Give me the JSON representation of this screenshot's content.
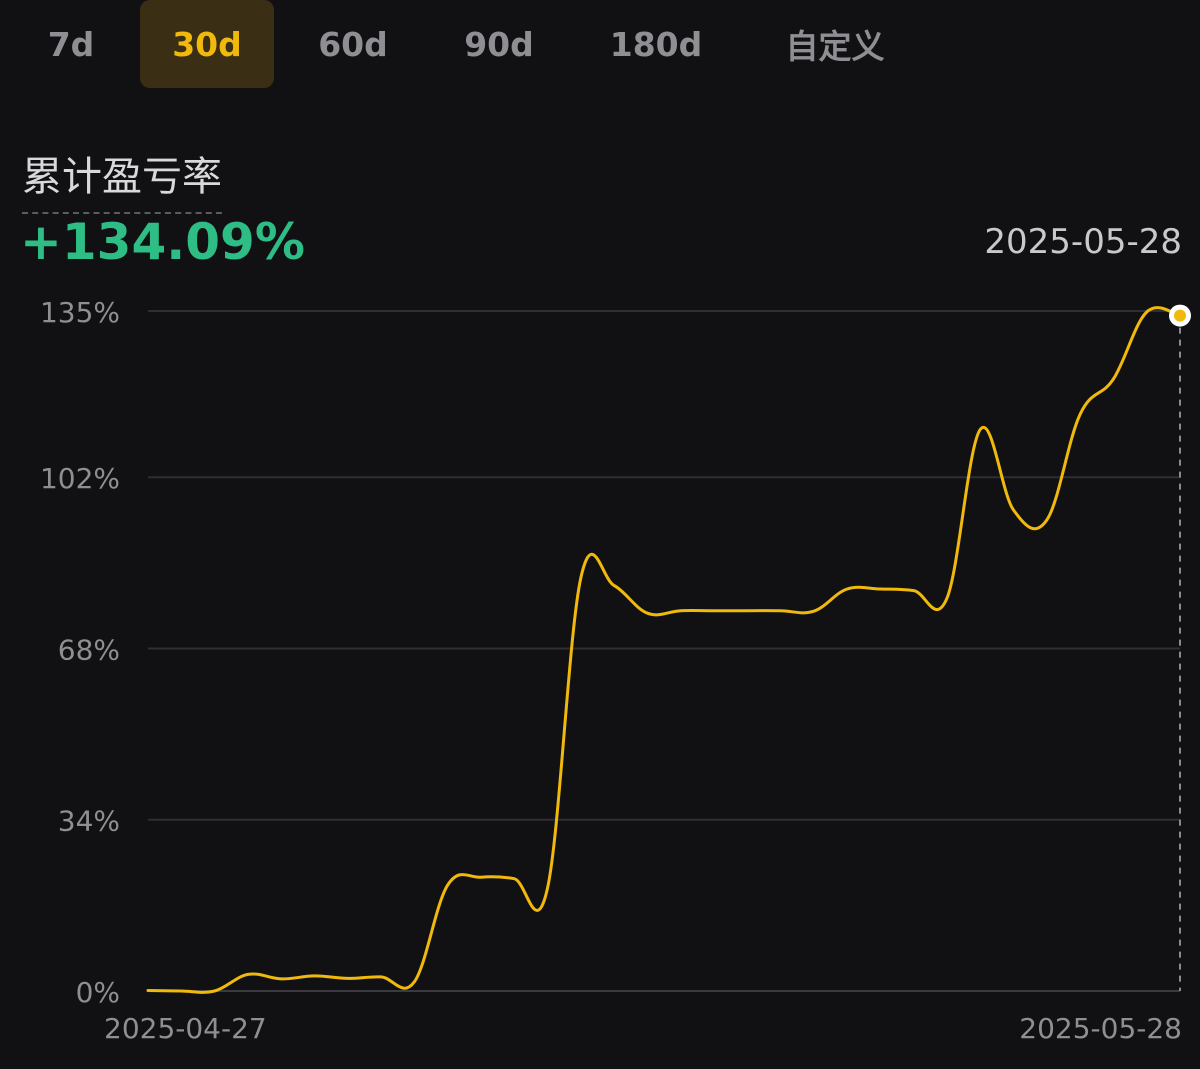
{
  "tabs": [
    {
      "label": "7d",
      "active": false
    },
    {
      "label": "30d",
      "active": true
    },
    {
      "label": "60d",
      "active": false
    },
    {
      "label": "90d",
      "active": false
    },
    {
      "label": "180d",
      "active": false
    },
    {
      "label": "自定义",
      "active": false
    }
  ],
  "metric": {
    "label": "累计盈亏率",
    "value": "+134.09%",
    "date": "2025-05-28"
  },
  "colors": {
    "accent": "#f0b90b",
    "positive": "#2ebd85",
    "background": "#111114",
    "grid": "#2e2e33"
  },
  "chart_data": {
    "type": "line",
    "y_ticks": [
      {
        "value": 0,
        "label": "0%"
      },
      {
        "value": 34,
        "label": "34%"
      },
      {
        "value": 68,
        "label": "68%"
      },
      {
        "value": 102,
        "label": "102%"
      },
      {
        "value": 135,
        "label": "135%"
      }
    ],
    "ylim": [
      0,
      135
    ],
    "x_ticks": [
      "2025-04-27",
      "2025-05-28"
    ],
    "xlim": [
      "2025-04-27",
      "2025-05-28"
    ],
    "grid": true,
    "series": [
      {
        "color": "#f0b90b",
        "points": [
          [
            "2025-04-27",
            0.1
          ],
          [
            "2025-04-28",
            0.0
          ],
          [
            "2025-04-29",
            0.0
          ],
          [
            "2025-04-30",
            3.3
          ],
          [
            "2025-05-01",
            2.4
          ],
          [
            "2025-05-02",
            3.0
          ],
          [
            "2025-05-03",
            2.5
          ],
          [
            "2025-05-04",
            2.8
          ],
          [
            "2025-05-05",
            1.8
          ],
          [
            "2025-05-06",
            21.0
          ],
          [
            "2025-05-07",
            22.6
          ],
          [
            "2025-05-08",
            22.3
          ],
          [
            "2025-05-09",
            20.4
          ],
          [
            "2025-05-10",
            82.0
          ],
          [
            "2025-05-11",
            80.5
          ],
          [
            "2025-05-12",
            75.0
          ],
          [
            "2025-05-13",
            75.5
          ],
          [
            "2025-05-14",
            75.5
          ],
          [
            "2025-05-15",
            75.5
          ],
          [
            "2025-05-16",
            75.5
          ],
          [
            "2025-05-17",
            75.4
          ],
          [
            "2025-05-18",
            79.8
          ],
          [
            "2025-05-19",
            79.8
          ],
          [
            "2025-05-20",
            79.5
          ],
          [
            "2025-05-21",
            78.0
          ],
          [
            "2025-05-22",
            111.5
          ],
          [
            "2025-05-23",
            95.5
          ],
          [
            "2025-05-24",
            93.5
          ],
          [
            "2025-05-25",
            114.5
          ],
          [
            "2025-05-26",
            121.5
          ],
          [
            "2025-05-27",
            134.8
          ],
          [
            "2025-05-28",
            134.09
          ]
        ]
      }
    ]
  }
}
